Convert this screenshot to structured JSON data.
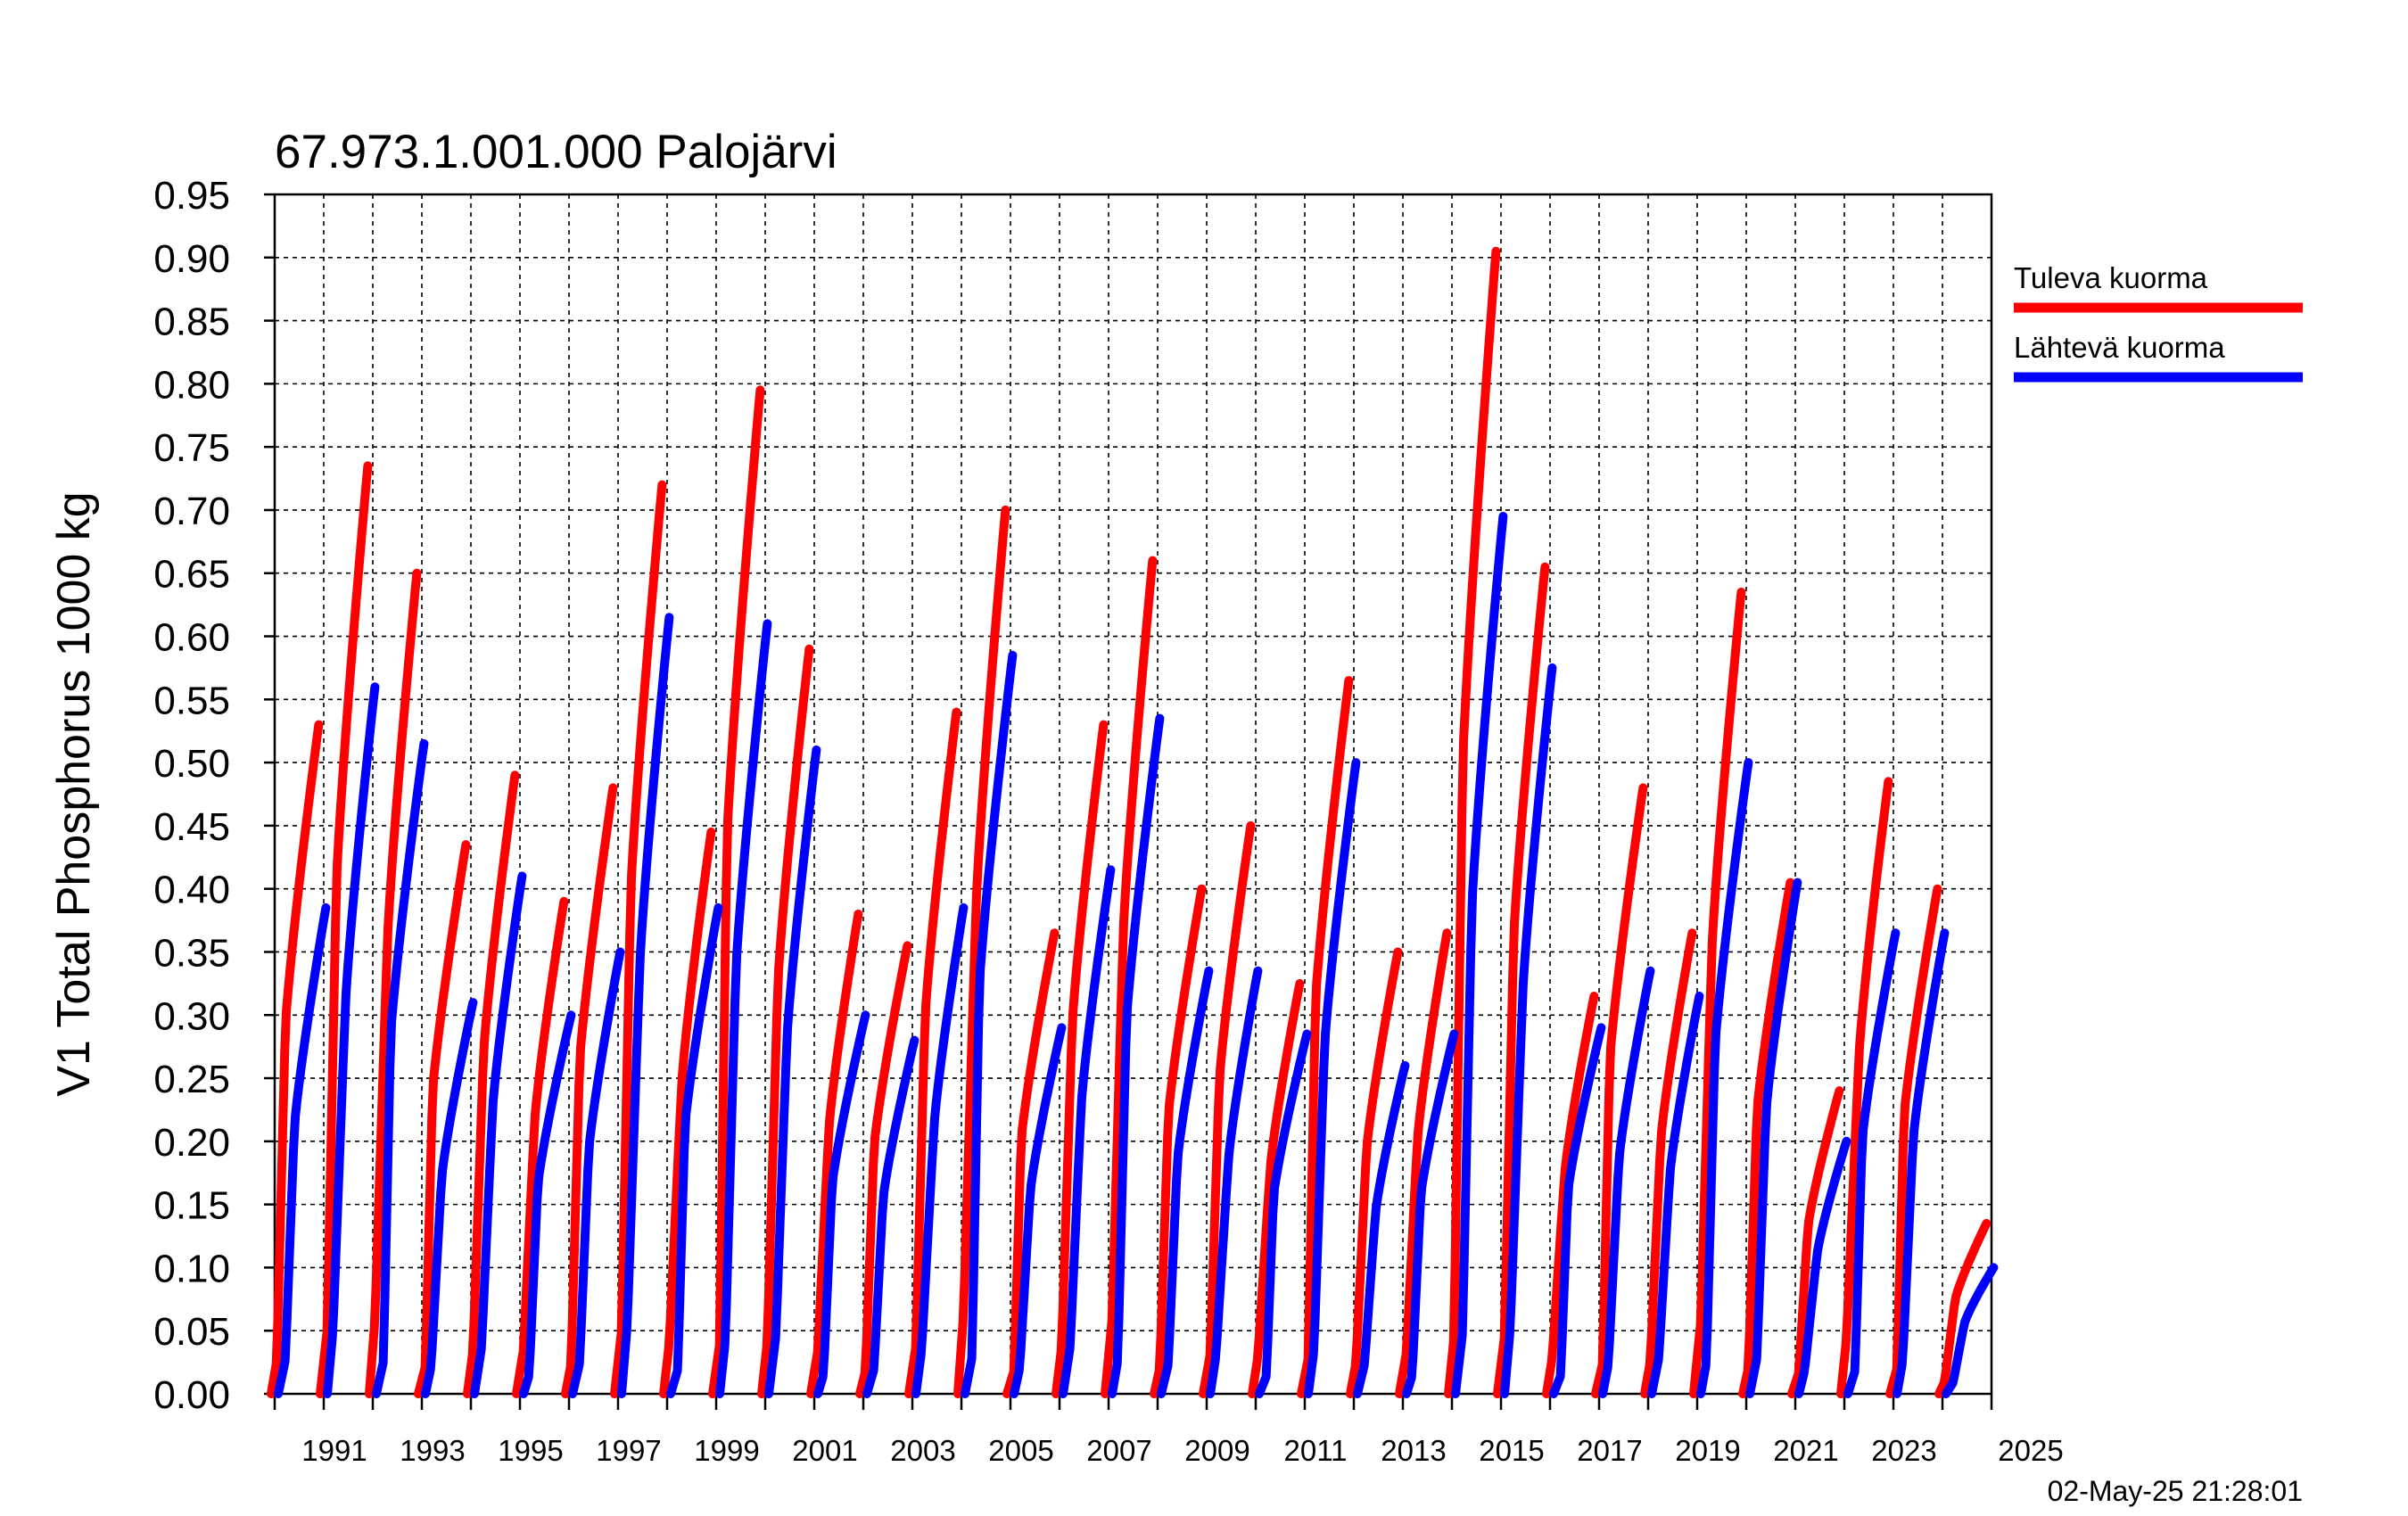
{
  "chart_data": {
    "type": "line",
    "title": "67.973.1.001.000 Palojärvi",
    "ylabel": "V1 Total Phosphorus 1000 kg",
    "xlabel": "",
    "timestamp": "02-May-25 21:28:01",
    "xlim": [
      1990,
      2025
    ],
    "ylim": [
      0,
      0.95
    ],
    "yticks": [
      "0.00",
      "0.05",
      "0.10",
      "0.15",
      "0.20",
      "0.25",
      "0.30",
      "0.35",
      "0.40",
      "0.45",
      "0.50",
      "0.55",
      "0.60",
      "0.65",
      "0.70",
      "0.75",
      "0.80",
      "0.85",
      "0.90",
      "0.95"
    ],
    "xtick_labels": [
      "1991",
      "1993",
      "1995",
      "1997",
      "1999",
      "2001",
      "2003",
      "2005",
      "2007",
      "2009",
      "2011",
      "2013",
      "2015",
      "2017",
      "2019",
      "2021",
      "2023",
      "2025"
    ],
    "grid": true,
    "legend_position": "right",
    "series": [
      {
        "name": "Tuleva kuorma",
        "color": "#ff0000",
        "years": [
          1990,
          1991,
          1992,
          1993,
          1994,
          1995,
          1996,
          1997,
          1998,
          1999,
          2000,
          2001,
          2002,
          2003,
          2004,
          2005,
          2006,
          2007,
          2008,
          2009,
          2010,
          2011,
          2012,
          2013,
          2014,
          2015,
          2016,
          2017,
          2018,
          2019,
          2020,
          2021,
          2022,
          2023,
          2024,
          2025
        ],
        "annual_totals": [
          0.53,
          0.735,
          0.65,
          0.435,
          0.49,
          0.39,
          0.48,
          0.72,
          0.445,
          0.795,
          0.59,
          0.38,
          0.355,
          0.54,
          0.7,
          0.365,
          0.53,
          0.66,
          0.4,
          0.45,
          0.325,
          0.565,
          0.35,
          0.365,
          0.905,
          0.655,
          0.315,
          0.48,
          0.365,
          0.635,
          0.405,
          0.24,
          0.485,
          0.4,
          0.135
        ]
      },
      {
        "name": "Lähtevä kuorma",
        "color": "#0000ff",
        "years": [
          1990,
          1991,
          1992,
          1993,
          1994,
          1995,
          1996,
          1997,
          1998,
          1999,
          2000,
          2001,
          2002,
          2003,
          2004,
          2005,
          2006,
          2007,
          2008,
          2009,
          2010,
          2011,
          2012,
          2013,
          2014,
          2015,
          2016,
          2017,
          2018,
          2019,
          2020,
          2021,
          2022,
          2023,
          2024,
          2025
        ],
        "annual_totals": [
          0.385,
          0.56,
          0.515,
          0.31,
          0.41,
          0.3,
          0.35,
          0.615,
          0.385,
          0.61,
          0.51,
          0.3,
          0.28,
          0.385,
          0.585,
          0.29,
          0.415,
          0.535,
          0.335,
          0.335,
          0.285,
          0.5,
          0.26,
          0.285,
          0.695,
          0.575,
          0.29,
          0.335,
          0.315,
          0.5,
          0.405,
          0.2,
          0.365,
          0.365,
          0.1
        ]
      }
    ]
  }
}
